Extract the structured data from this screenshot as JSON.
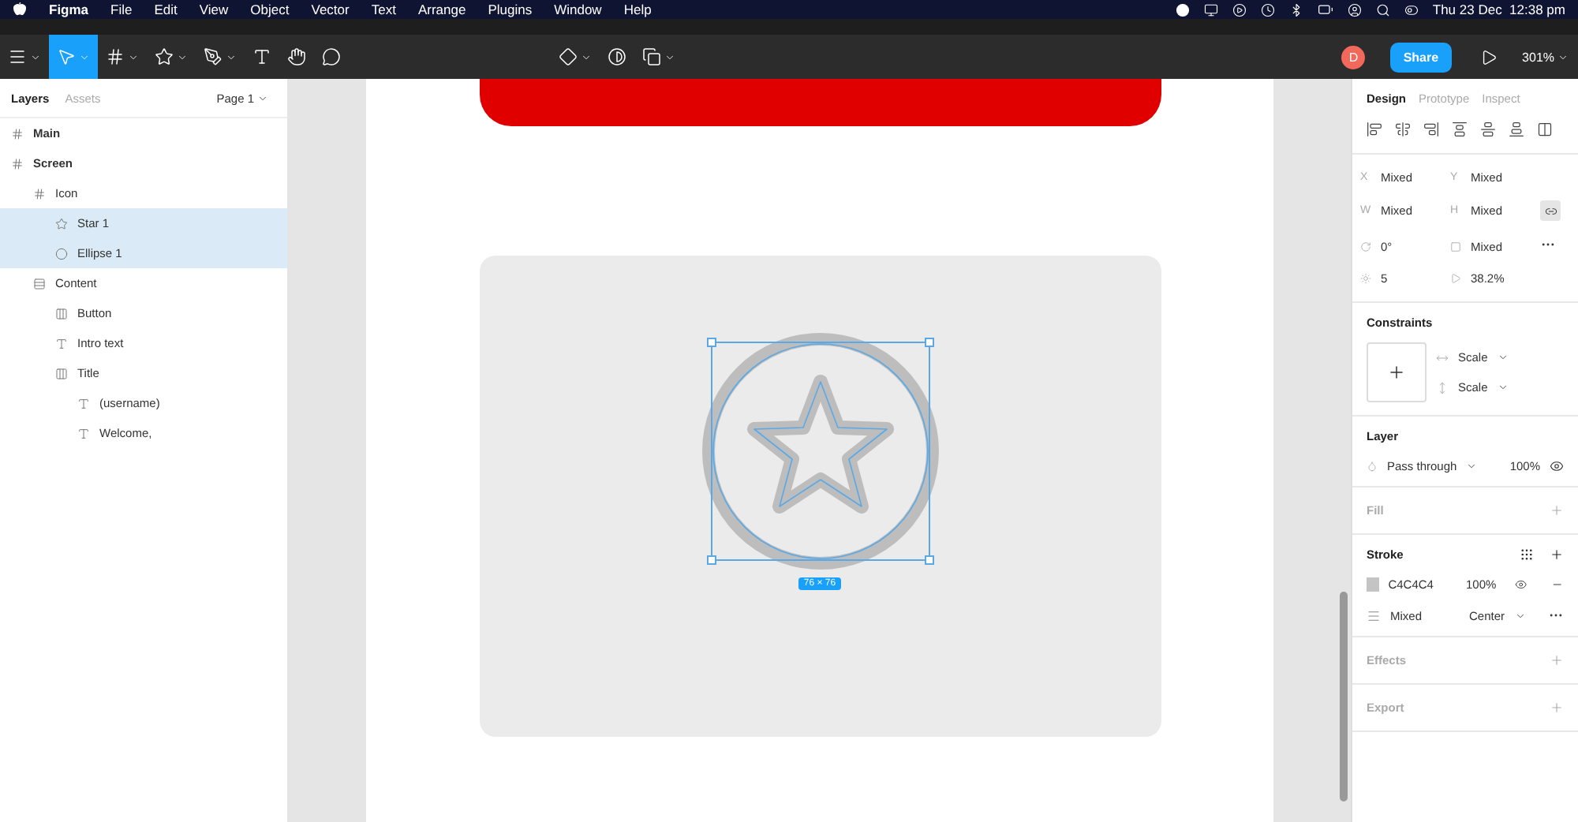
{
  "menubar": {
    "app": "Figma",
    "menus": [
      "File",
      "Edit",
      "View",
      "Object",
      "Vector",
      "Text",
      "Arrange",
      "Plugins",
      "Window",
      "Help"
    ],
    "clock": "Thu 23 Dec  12:38 pm"
  },
  "toolbar": {
    "tools": [
      {
        "kind": "figma",
        "selected": false
      },
      {
        "kind": "move",
        "selected": true
      },
      {
        "kind": "frame",
        "selected": false
      },
      {
        "kind": "shape",
        "selected": false
      },
      {
        "kind": "pen",
        "selected": false
      },
      {
        "kind": "text",
        "selected": false
      },
      {
        "kind": "hand",
        "selected": false
      },
      {
        "kind": "comment",
        "selected": false
      }
    ],
    "avatar": "D",
    "share": "Share",
    "zoom": "301%"
  },
  "layers_panel": {
    "tabs": [
      {
        "label": "Layers",
        "selected": true
      },
      {
        "label": "Assets",
        "selected": false
      }
    ],
    "page": "Page 1",
    "layers": [
      {
        "name": "Main",
        "kind": "frame",
        "selected": false,
        "top": true
      },
      {
        "name": "Screen",
        "kind": "frame",
        "selected": false,
        "top": true,
        "children": [
          {
            "name": "Icon",
            "kind": "frame",
            "selected": false,
            "children": [
              {
                "name": "Star 1",
                "kind": "star",
                "selected": true
              },
              {
                "name": "Ellipse 1",
                "kind": "ellipse",
                "selected": true
              }
            ]
          },
          {
            "name": "Content",
            "kind": "autolayout",
            "selected": false,
            "children": [
              {
                "name": "Button",
                "kind": "autolayout-h",
                "selected": false
              },
              {
                "name": "Intro text",
                "kind": "text",
                "selected": false
              },
              {
                "name": "Title",
                "kind": "autolayout-h",
                "selected": false,
                "children": [
                  {
                    "name": "(username)",
                    "kind": "text",
                    "selected": false
                  },
                  {
                    "name": "Welcome,",
                    "kind": "text",
                    "selected": false
                  }
                ]
              }
            ]
          }
        ]
      }
    ]
  },
  "canvas": {
    "selection_size": "76 × 76"
  },
  "design_panel": {
    "tabs": [
      {
        "label": "Design",
        "selected": true
      },
      {
        "label": "Prototype",
        "selected": false
      },
      {
        "label": "Inspect",
        "selected": false
      }
    ],
    "fields": [
      {
        "kind": "letter",
        "label": "X",
        "value": "Mixed"
      },
      {
        "kind": "letter",
        "label": "Y",
        "value": "Mixed"
      },
      {
        "kind": "letter",
        "label": "W",
        "value": "Mixed"
      },
      {
        "kind": "letter",
        "label": "H",
        "value": "Mixed"
      },
      {
        "kind": "rotation",
        "value": "0°"
      },
      {
        "kind": "corner",
        "value": "Mixed"
      },
      {
        "kind": "count",
        "value": "5"
      },
      {
        "kind": "ratio",
        "value": "38.2%"
      }
    ],
    "constraints": {
      "title": "Constraints",
      "horizontal": "Scale",
      "vertical": "Scale"
    },
    "layer": {
      "title": "Layer",
      "blend": "Pass through",
      "opacity": "100%"
    },
    "fill": {
      "title": "Fill"
    },
    "stroke": {
      "title": "Stroke",
      "hex": "C4C4C4",
      "color": "#c4c4c4",
      "opacity": "100%",
      "weight": "Mixed",
      "align": "Center"
    },
    "effects": {
      "title": "Effects"
    },
    "export": {
      "title": "Export"
    }
  }
}
